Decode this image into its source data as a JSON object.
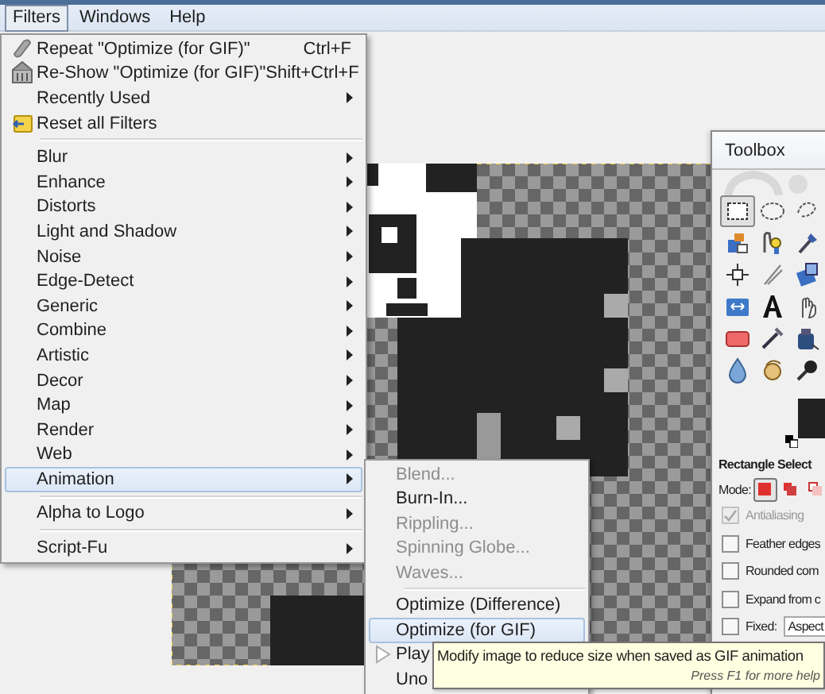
{
  "menubar": [
    {
      "label": "Filters",
      "selected": true
    },
    {
      "label": "Windows",
      "selected": false
    },
    {
      "label": "Help",
      "selected": false
    }
  ],
  "filters_menu": {
    "items": [
      {
        "kind": "repeat",
        "label": "Repeat \"Optimize (for GIF)\"",
        "shortcut": "Ctrl+F",
        "selected": false
      },
      {
        "kind": "reshow",
        "label": "Re-Show \"Optimize (for GIF)\"",
        "shortcut": "Shift+Ctrl+F",
        "selected": false
      },
      {
        "kind": "submenu",
        "label": "Recently Used",
        "selected": false
      },
      {
        "kind": "reset",
        "label": "Reset all Filters",
        "selected": false
      },
      {
        "kind": "separator"
      },
      {
        "kind": "submenu",
        "label": "Blur",
        "selected": false
      },
      {
        "kind": "submenu",
        "label": "Enhance",
        "selected": false
      },
      {
        "kind": "submenu",
        "label": "Distorts",
        "selected": false
      },
      {
        "kind": "submenu",
        "label": "Light and Shadow",
        "selected": false
      },
      {
        "kind": "submenu",
        "label": "Noise",
        "selected": false
      },
      {
        "kind": "submenu",
        "label": "Edge-Detect",
        "selected": false
      },
      {
        "kind": "submenu",
        "label": "Generic",
        "selected": false
      },
      {
        "kind": "submenu",
        "label": "Combine",
        "selected": false
      },
      {
        "kind": "submenu",
        "label": "Artistic",
        "selected": false
      },
      {
        "kind": "submenu",
        "label": "Decor",
        "selected": false
      },
      {
        "kind": "submenu",
        "label": "Map",
        "selected": false
      },
      {
        "kind": "submenu",
        "label": "Render",
        "selected": false
      },
      {
        "kind": "submenu",
        "label": "Web",
        "selected": false
      },
      {
        "kind": "submenu",
        "label": "Animation",
        "selected": true
      },
      {
        "kind": "separator"
      },
      {
        "kind": "submenu",
        "label": "Alpha to Logo",
        "selected": false
      },
      {
        "kind": "separator"
      },
      {
        "kind": "submenu",
        "label": "Script-Fu",
        "selected": false
      }
    ]
  },
  "animation_submenu": {
    "items": [
      {
        "kind": "command",
        "label": "Blend...",
        "selected": false,
        "disabled": true
      },
      {
        "kind": "command",
        "label": "Burn-In...",
        "selected": false,
        "disabled": false
      },
      {
        "kind": "command",
        "label": "Rippling...",
        "selected": false,
        "disabled": true
      },
      {
        "kind": "command",
        "label": "Spinning Globe...",
        "selected": false,
        "disabled": true
      },
      {
        "kind": "command",
        "label": "Waves...",
        "selected": false,
        "disabled": true
      },
      {
        "kind": "separator"
      },
      {
        "kind": "command",
        "label": "Optimize (Difference)",
        "selected": false,
        "disabled": false
      },
      {
        "kind": "command",
        "label": "Optimize (for GIF)",
        "selected": true,
        "disabled": false
      },
      {
        "kind": "play",
        "label": "Play",
        "selected": false,
        "disabled": false
      },
      {
        "kind": "command",
        "label": "Uno",
        "selected": false,
        "disabled": false
      }
    ]
  },
  "tooltip": {
    "text": "Modify image to reduce size when saved as GIF animation",
    "hint": "Press F1 for more help"
  },
  "toolbox": {
    "title": "Toolbox",
    "tools": [
      {
        "selected": true
      },
      {
        "selected": false
      },
      {
        "selected": false
      },
      {
        "selected": false
      },
      {
        "selected": false
      },
      {
        "selected": false
      },
      {
        "selected": false
      },
      {
        "selected": false
      },
      {
        "selected": false
      },
      {
        "selected": false
      },
      {
        "selected": false
      },
      {
        "selected": false
      },
      {
        "selected": false
      },
      {
        "selected": false
      },
      {
        "selected": false
      },
      {
        "selected": false
      },
      {
        "selected": false
      },
      {
        "selected": false
      }
    ],
    "tool_name": "Rectangle Select",
    "mode_label": "Mode:",
    "modes": [
      {
        "selected": true
      },
      {
        "selected": false
      },
      {
        "selected": false
      }
    ],
    "options": [
      {
        "kind": "checkbox",
        "label": "Antialiasing",
        "checked": true,
        "disabled": true
      },
      {
        "kind": "checkbox",
        "label": "Feather edges",
        "checked": false,
        "disabled": false
      },
      {
        "kind": "checkbox",
        "label": "Rounded com",
        "checked": false,
        "disabled": false
      },
      {
        "kind": "checkbox",
        "label": "Expand from c",
        "checked": false,
        "disabled": false
      },
      {
        "kind": "dropdown",
        "label": "Fixed:",
        "checked": false,
        "disabled": false,
        "value": "Aspect"
      }
    ]
  }
}
